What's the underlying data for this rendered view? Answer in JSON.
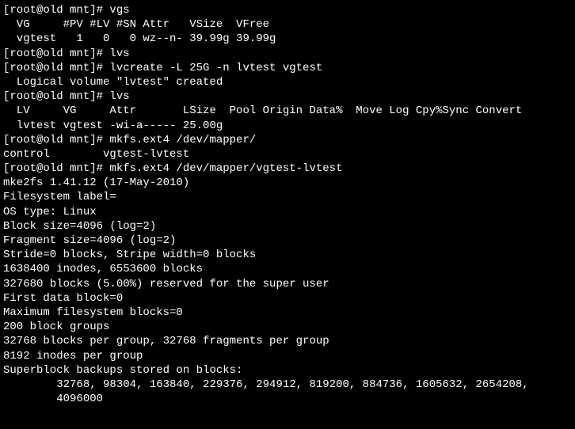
{
  "lines": [
    "[root@old mnt]# vgs",
    "  VG     #PV #LV #SN Attr   VSize  VFree",
    "  vgtest   1   0   0 wz--n- 39.99g 39.99g",
    "[root@old mnt]# lvs",
    "[root@old mnt]# lvcreate -L 25G -n lvtest vgtest",
    "  Logical volume \"lvtest\" created",
    "[root@old mnt]# lvs",
    "  LV     VG     Attr       LSize  Pool Origin Data%  Move Log Cpy%Sync Convert",
    "  lvtest vgtest -wi-a----- 25.00g",
    "[root@old mnt]# mkfs.ext4 /dev/mapper/",
    "control        vgtest-lvtest",
    "[root@old mnt]# mkfs.ext4 /dev/mapper/vgtest-lvtest",
    "mke2fs 1.41.12 (17-May-2010)",
    "Filesystem label=",
    "OS type: Linux",
    "Block size=4096 (log=2)",
    "Fragment size=4096 (log=2)",
    "Stride=0 blocks, Stripe width=0 blocks",
    "1638400 inodes, 6553600 blocks",
    "327680 blocks (5.00%) reserved for the super user",
    "First data block=0",
    "Maximum filesystem blocks=0",
    "200 block groups",
    "32768 blocks per group, 32768 fragments per group",
    "8192 inodes per group",
    "Superblock backups stored on blocks:",
    "        32768, 98304, 163840, 229376, 294912, 819200, 884736, 1605632, 2654208,",
    "        4096000"
  ]
}
